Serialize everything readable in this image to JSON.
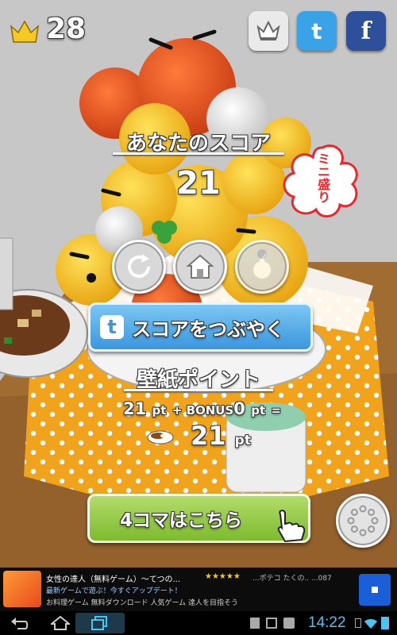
{
  "hud": {
    "level_count": "28"
  },
  "share": {
    "ranking_icon": "crown-icon",
    "twitter_letter": "t",
    "facebook_letter": "f"
  },
  "score": {
    "title": "あなたのスコア",
    "value": "21",
    "badge_text": "ミニ盛り"
  },
  "actions": {
    "retry_icon": "retry-icon",
    "home_icon": "home-icon",
    "bomb_icon": "bomb-icon"
  },
  "tweet": {
    "label": "スコアをつぶやく",
    "icon_letter": "t"
  },
  "wallpaper": {
    "title": "壁紙ポイント",
    "score_pt": "21",
    "pt_unit": "pt",
    "plus_bonus": "+ BONUS",
    "bonus_pt": "0",
    "equals": "=",
    "total_pt": "21"
  },
  "comic": {
    "label": "4コマはこちら",
    "more_icon": "more-icon"
  },
  "ad": {
    "line1": "女性の達人（無料ゲーム）～てつの...",
    "rating": "★★★★★",
    "line1_right": "...ポテコ たくの.. ...087",
    "line2": "最新ゲームで遊ぶ！今すぐアップデート！",
    "line3": "お料理ゲーム 無料ダウンロード 人気ゲーム 達人を目指そう"
  },
  "statusbar": {
    "time": "14:22"
  },
  "colors": {
    "score_badge_red": "#e8282d",
    "tweet_blue": "#49a7e8",
    "comic_green": "#8cc43a",
    "twitter": "#3aa2e6",
    "facebook": "#2e4f9a"
  }
}
